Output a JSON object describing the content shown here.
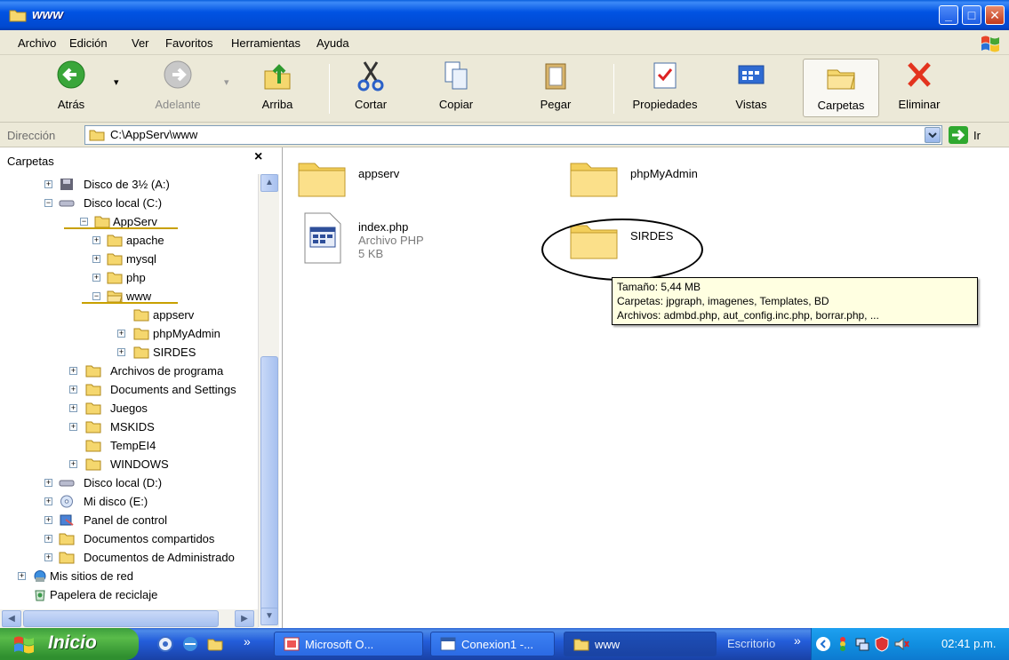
{
  "window": {
    "title": "www",
    "min": "_",
    "max": "□",
    "close": "✕"
  },
  "menu": [
    "Archivo",
    "Edición",
    "Ver",
    "Favoritos",
    "Herramientas",
    "Ayuda"
  ],
  "toolbar": {
    "back": "Atrás",
    "forward": "Adelante",
    "up": "Arriba",
    "cut": "Cortar",
    "copy": "Copiar",
    "paste": "Pegar",
    "properties": "Propiedades",
    "views": "Vistas",
    "folders": "Carpetas",
    "delete": "Eliminar"
  },
  "address": {
    "label": "Dirección",
    "value": "C:\\AppServ\\www",
    "go": "Ir"
  },
  "folders_panel": {
    "title": "Carpetas",
    "close": "×",
    "items": [
      {
        "label": "Disco de 3½ (A:)"
      },
      {
        "label": "Disco local (C:)"
      },
      {
        "label": "AppServ"
      },
      {
        "label": "apache"
      },
      {
        "label": "mysql"
      },
      {
        "label": "php"
      },
      {
        "label": "www"
      },
      {
        "label": "appserv"
      },
      {
        "label": "phpMyAdmin"
      },
      {
        "label": "SIRDES"
      },
      {
        "label": "Archivos de programa"
      },
      {
        "label": "Documents and Settings"
      },
      {
        "label": "Juegos"
      },
      {
        "label": "MSKIDS"
      },
      {
        "label": "TempEI4"
      },
      {
        "label": "WINDOWS"
      },
      {
        "label": "Disco local (D:)"
      },
      {
        "label": "Mi disco (E:)"
      },
      {
        "label": "Panel de control"
      },
      {
        "label": "Documentos compartidos"
      },
      {
        "label": "Documentos de Administrado"
      },
      {
        "label": "Mis sitios de red"
      },
      {
        "label": "Papelera de reciclaje"
      }
    ]
  },
  "content": {
    "appserv": "appserv",
    "phpmyadmin": "phpMyAdmin",
    "index_name": "index.php",
    "index_type": "Archivo PHP",
    "index_size": "5 KB",
    "sirdes": "SIRDES"
  },
  "tooltip": {
    "line1": "Tamaño: 5,44 MB",
    "line2": "Carpetas: jpgraph, imagenes, Templates, BD",
    "line3": "Archivos: admbd.php, aut_config.inc.php, borrar.php, ..."
  },
  "taskbar": {
    "start": "Inicio",
    "chevron": "»",
    "tasks": [
      "Microsoft O...",
      "Conexion1 -...",
      "www"
    ],
    "desktop": "Escritorio",
    "clock": "02:41 p.m."
  }
}
